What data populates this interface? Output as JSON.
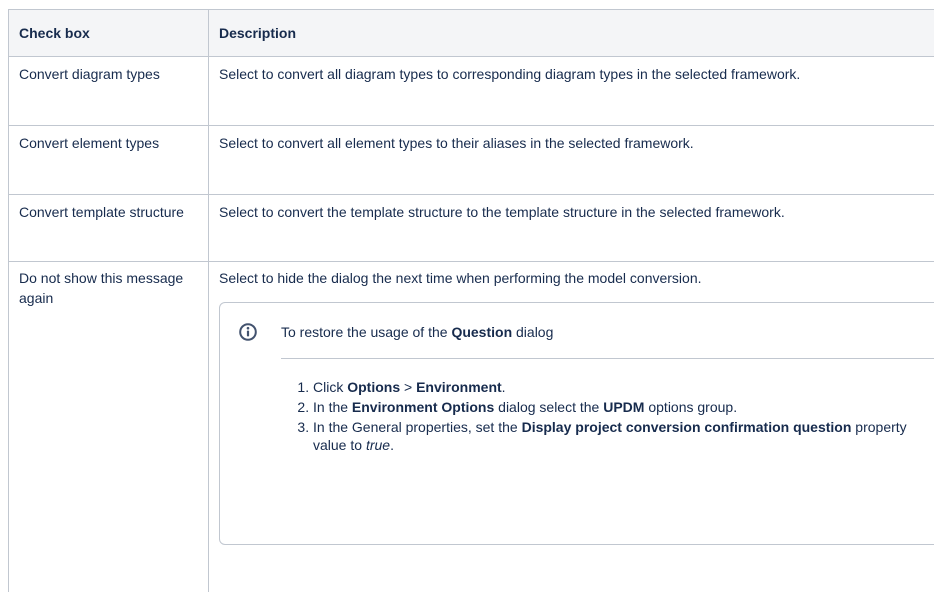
{
  "table": {
    "headers": [
      "Check box",
      "Description"
    ],
    "rows": [
      {
        "checkbox": "Convert diagram types",
        "description": "Select to convert all diagram types to corresponding diagram types in the selected framework."
      },
      {
        "checkbox": "Convert element types",
        "description": "Select to convert all element types to their aliases in the selected framework."
      },
      {
        "checkbox": "Convert template structure",
        "description": "Select to convert the template structure to the template structure in the selected framework."
      },
      {
        "checkbox": "Do not show this message again",
        "description": "Select to hide the dialog the next time when performing the model conversion."
      }
    ]
  },
  "info_panel": {
    "icon": "info-icon",
    "title_pre": "To restore the usage of the ",
    "title_bold": "Question",
    "title_post": " dialog",
    "steps": [
      {
        "s1_pre": "Click ",
        "s1_b1": "Options",
        "s1_mid": " > ",
        "s1_b2": "Environment",
        "s1_post": "."
      },
      {
        "s2_pre": "In the ",
        "s2_b1": "Environment Options",
        "s2_mid": " dialog select the ",
        "s2_b2": "UPDM",
        "s2_post": " options group."
      },
      {
        "s3_pre": "In the General properties, set the ",
        "s3_b1": "Display project conversion confirmation question",
        "s3_mid": " property value to ",
        "s3_i": "true",
        "s3_post": "."
      }
    ]
  },
  "colors": {
    "border": "#c1c7d0",
    "header_bg": "#f4f5f7",
    "text": "#172b4d",
    "info_icon": "#42526e"
  }
}
